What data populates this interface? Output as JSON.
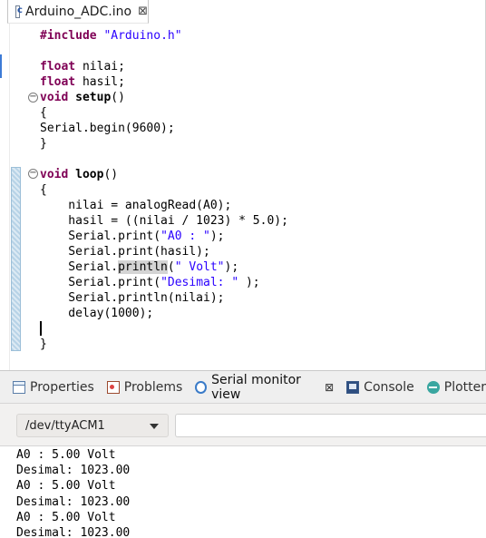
{
  "editor": {
    "tab_title": "Arduino_ADC.ino",
    "tab_close": "⊠",
    "code": {
      "l1_directive": "#include",
      "l1_string": "\"Arduino.h\"",
      "l3_type": "float",
      "l3_rest": " nilai;",
      "l4_type": "float",
      "l4_rest": " hasil;",
      "l5_type": "void",
      "l5_name": " setup",
      "l5_rest": "()",
      "l6": "{",
      "l7": "Serial.begin(9600);",
      "l8": "}",
      "l10_type": "void",
      "l10_name": " loop",
      "l10_rest": "()",
      "l11": "{",
      "l12": "    nilai = analogRead(A0);",
      "l13": "    hasil = ((nilai / 1023) * 5.0);",
      "l14_a": "    Serial.print(",
      "l14_str": "\"A0 : \"",
      "l14_b": ");",
      "l15": "    Serial.print(hasil);",
      "l16_a": "    Serial.",
      "l16_hl": "println",
      "l16_b": "(",
      "l16_str": "\" Volt\"",
      "l16_c": ");",
      "l17_a": "    Serial.print(",
      "l17_str": "\"Desimal: \"",
      "l17_b": " );",
      "l18": "    Serial.println(nilai);",
      "l19": "    delay(1000);",
      "l21": "}"
    },
    "fold_symbol": "⊖"
  },
  "views": {
    "tabs": [
      {
        "label": "Properties",
        "icon": "properties-icon"
      },
      {
        "label": "Problems",
        "icon": "problems-icon"
      },
      {
        "label": "Serial monitor view",
        "icon": "serial-monitor-icon",
        "active": true,
        "close": "⊠"
      },
      {
        "label": "Console",
        "icon": "console-icon"
      },
      {
        "label": "Plotter",
        "icon": "plotter-icon"
      }
    ],
    "port": "/dev/ttyACM1",
    "send_value": "",
    "output": [
      "A0 : 5.00 Volt",
      "Desimal: 1023.00",
      "A0 : 5.00 Volt",
      "Desimal: 1023.00",
      "A0 : 5.00 Volt",
      "Desimal: 1023.00"
    ]
  },
  "colors": {
    "keyword": "#7f0055",
    "string": "#2a00ff",
    "accent": "#3d7bd6"
  }
}
